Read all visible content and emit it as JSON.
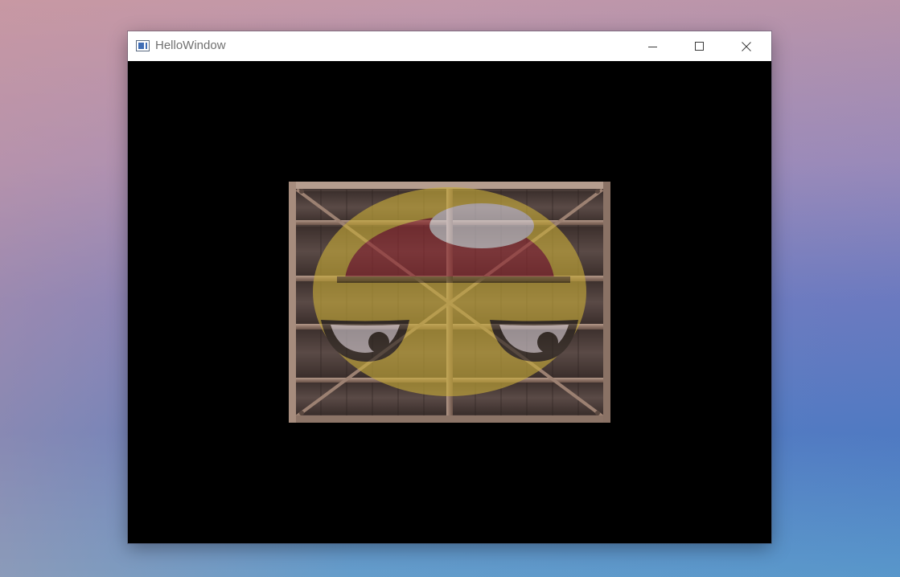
{
  "window": {
    "title": "HelloWindow",
    "icon": "application-window-icon",
    "controls": {
      "minimize_icon": "minimize-icon",
      "maximize_icon": "maximize-icon",
      "close_icon": "close-icon"
    }
  },
  "render": {
    "clear_color": "#000000",
    "content": "textured-quad",
    "texture_base": "wooden-crate",
    "texture_overlay": "smiley-face"
  }
}
